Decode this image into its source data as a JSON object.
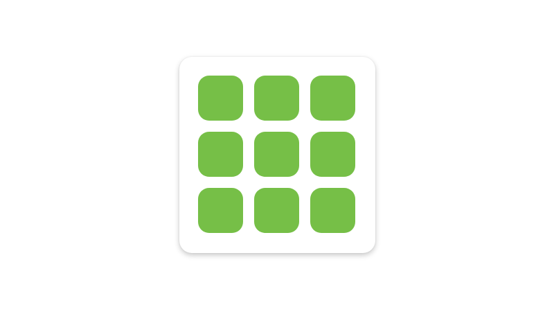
{
  "icon": {
    "name": "apps-grid-icon",
    "tile_color": "#76bf47",
    "background_color": "#ffffff",
    "rows": 3,
    "columns": 3
  }
}
